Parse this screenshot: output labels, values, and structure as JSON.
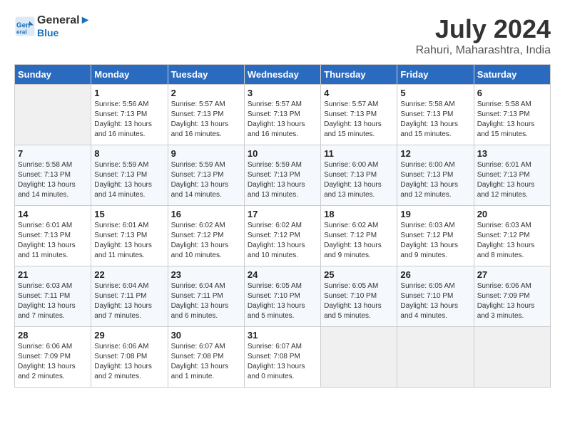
{
  "header": {
    "logo_line1": "General",
    "logo_line2": "Blue",
    "month_year": "July 2024",
    "location": "Rahuri, Maharashtra, India"
  },
  "days_of_week": [
    "Sunday",
    "Monday",
    "Tuesday",
    "Wednesday",
    "Thursday",
    "Friday",
    "Saturday"
  ],
  "weeks": [
    [
      {
        "day": "",
        "info": ""
      },
      {
        "day": "1",
        "info": "Sunrise: 5:56 AM\nSunset: 7:13 PM\nDaylight: 13 hours\nand 16 minutes."
      },
      {
        "day": "2",
        "info": "Sunrise: 5:57 AM\nSunset: 7:13 PM\nDaylight: 13 hours\nand 16 minutes."
      },
      {
        "day": "3",
        "info": "Sunrise: 5:57 AM\nSunset: 7:13 PM\nDaylight: 13 hours\nand 16 minutes."
      },
      {
        "day": "4",
        "info": "Sunrise: 5:57 AM\nSunset: 7:13 PM\nDaylight: 13 hours\nand 15 minutes."
      },
      {
        "day": "5",
        "info": "Sunrise: 5:58 AM\nSunset: 7:13 PM\nDaylight: 13 hours\nand 15 minutes."
      },
      {
        "day": "6",
        "info": "Sunrise: 5:58 AM\nSunset: 7:13 PM\nDaylight: 13 hours\nand 15 minutes."
      }
    ],
    [
      {
        "day": "7",
        "info": "Sunrise: 5:58 AM\nSunset: 7:13 PM\nDaylight: 13 hours\nand 14 minutes."
      },
      {
        "day": "8",
        "info": "Sunrise: 5:59 AM\nSunset: 7:13 PM\nDaylight: 13 hours\nand 14 minutes."
      },
      {
        "day": "9",
        "info": "Sunrise: 5:59 AM\nSunset: 7:13 PM\nDaylight: 13 hours\nand 14 minutes."
      },
      {
        "day": "10",
        "info": "Sunrise: 5:59 AM\nSunset: 7:13 PM\nDaylight: 13 hours\nand 13 minutes."
      },
      {
        "day": "11",
        "info": "Sunrise: 6:00 AM\nSunset: 7:13 PM\nDaylight: 13 hours\nand 13 minutes."
      },
      {
        "day": "12",
        "info": "Sunrise: 6:00 AM\nSunset: 7:13 PM\nDaylight: 13 hours\nand 12 minutes."
      },
      {
        "day": "13",
        "info": "Sunrise: 6:01 AM\nSunset: 7:13 PM\nDaylight: 13 hours\nand 12 minutes."
      }
    ],
    [
      {
        "day": "14",
        "info": "Sunrise: 6:01 AM\nSunset: 7:13 PM\nDaylight: 13 hours\nand 11 minutes."
      },
      {
        "day": "15",
        "info": "Sunrise: 6:01 AM\nSunset: 7:13 PM\nDaylight: 13 hours\nand 11 minutes."
      },
      {
        "day": "16",
        "info": "Sunrise: 6:02 AM\nSunset: 7:12 PM\nDaylight: 13 hours\nand 10 minutes."
      },
      {
        "day": "17",
        "info": "Sunrise: 6:02 AM\nSunset: 7:12 PM\nDaylight: 13 hours\nand 10 minutes."
      },
      {
        "day": "18",
        "info": "Sunrise: 6:02 AM\nSunset: 7:12 PM\nDaylight: 13 hours\nand 9 minutes."
      },
      {
        "day": "19",
        "info": "Sunrise: 6:03 AM\nSunset: 7:12 PM\nDaylight: 13 hours\nand 9 minutes."
      },
      {
        "day": "20",
        "info": "Sunrise: 6:03 AM\nSunset: 7:12 PM\nDaylight: 13 hours\nand 8 minutes."
      }
    ],
    [
      {
        "day": "21",
        "info": "Sunrise: 6:03 AM\nSunset: 7:11 PM\nDaylight: 13 hours\nand 7 minutes."
      },
      {
        "day": "22",
        "info": "Sunrise: 6:04 AM\nSunset: 7:11 PM\nDaylight: 13 hours\nand 7 minutes."
      },
      {
        "day": "23",
        "info": "Sunrise: 6:04 AM\nSunset: 7:11 PM\nDaylight: 13 hours\nand 6 minutes."
      },
      {
        "day": "24",
        "info": "Sunrise: 6:05 AM\nSunset: 7:10 PM\nDaylight: 13 hours\nand 5 minutes."
      },
      {
        "day": "25",
        "info": "Sunrise: 6:05 AM\nSunset: 7:10 PM\nDaylight: 13 hours\nand 5 minutes."
      },
      {
        "day": "26",
        "info": "Sunrise: 6:05 AM\nSunset: 7:10 PM\nDaylight: 13 hours\nand 4 minutes."
      },
      {
        "day": "27",
        "info": "Sunrise: 6:06 AM\nSunset: 7:09 PM\nDaylight: 13 hours\nand 3 minutes."
      }
    ],
    [
      {
        "day": "28",
        "info": "Sunrise: 6:06 AM\nSunset: 7:09 PM\nDaylight: 13 hours\nand 2 minutes."
      },
      {
        "day": "29",
        "info": "Sunrise: 6:06 AM\nSunset: 7:08 PM\nDaylight: 13 hours\nand 2 minutes."
      },
      {
        "day": "30",
        "info": "Sunrise: 6:07 AM\nSunset: 7:08 PM\nDaylight: 13 hours\nand 1 minute."
      },
      {
        "day": "31",
        "info": "Sunrise: 6:07 AM\nSunset: 7:08 PM\nDaylight: 13 hours\nand 0 minutes."
      },
      {
        "day": "",
        "info": ""
      },
      {
        "day": "",
        "info": ""
      },
      {
        "day": "",
        "info": ""
      }
    ]
  ]
}
